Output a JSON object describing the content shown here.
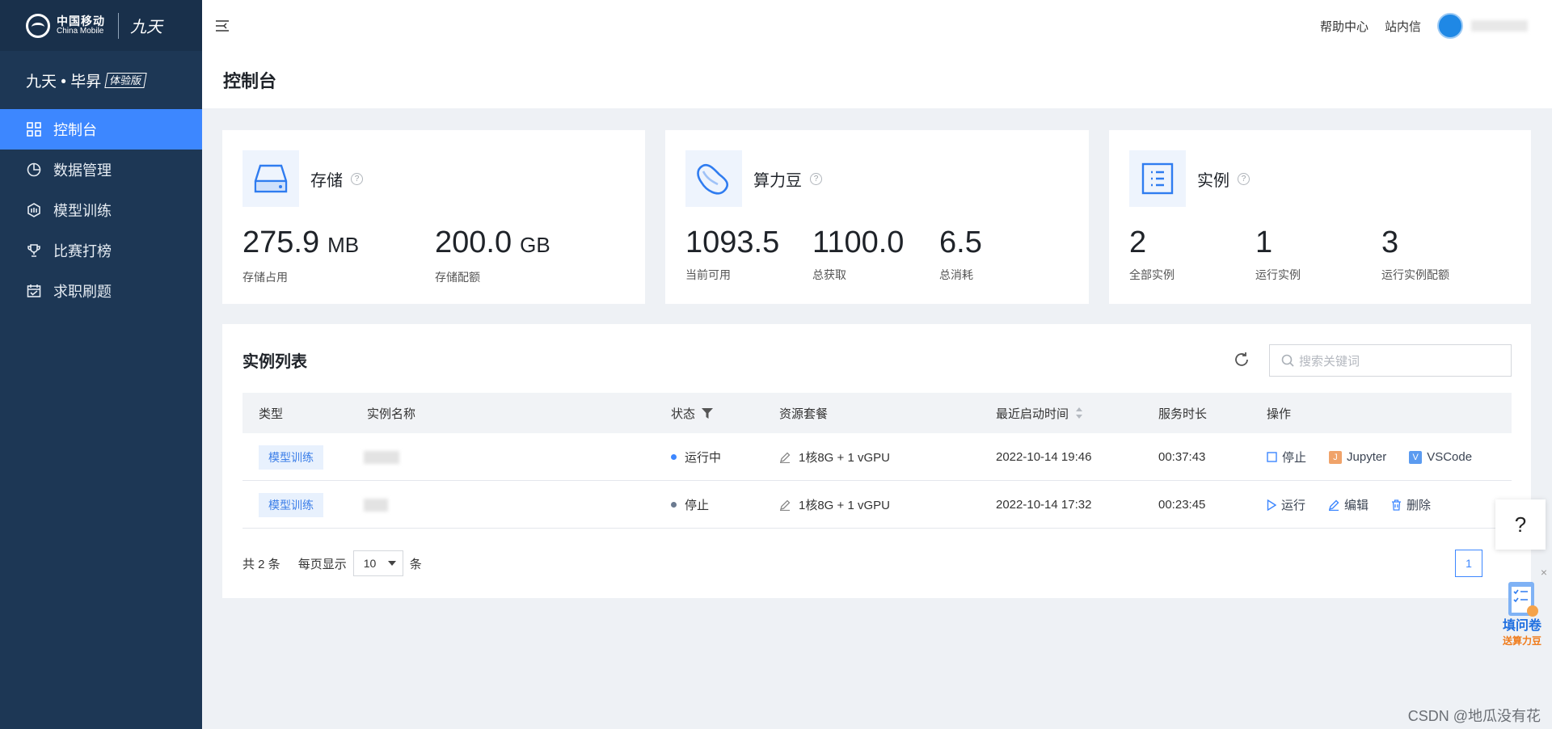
{
  "logo": {
    "cn": "中国移动",
    "en": "China Mobile",
    "script": "九天"
  },
  "brand": {
    "name": "九天 • 毕昇",
    "tag": "体验版"
  },
  "sidebar": {
    "items": [
      {
        "label": "控制台",
        "icon": "grid-icon",
        "active": true
      },
      {
        "label": "数据管理",
        "icon": "pie-chart-icon"
      },
      {
        "label": "模型训练",
        "icon": "hexagon-cube-icon"
      },
      {
        "label": "比赛打榜",
        "icon": "trophy-icon"
      },
      {
        "label": "求职刷题",
        "icon": "calendar-check-icon"
      }
    ]
  },
  "header": {
    "help": "帮助中心",
    "messages": "站内信"
  },
  "page": {
    "title": "控制台"
  },
  "cards": {
    "storage": {
      "title": "存储",
      "used": {
        "value": "275.9",
        "unit": "MB",
        "label": "存储占用"
      },
      "quota": {
        "value": "200.0",
        "unit": "GB",
        "label": "存储配额"
      }
    },
    "beans": {
      "title": "算力豆",
      "available": {
        "value": "1093.5",
        "label": "当前可用"
      },
      "earned": {
        "value": "1100.0",
        "label": "总获取"
      },
      "spent": {
        "value": "6.5",
        "label": "总消耗"
      }
    },
    "instances": {
      "title": "实例",
      "all": {
        "value": "2",
        "label": "全部实例"
      },
      "running": {
        "value": "1",
        "label": "运行实例"
      },
      "quota": {
        "value": "3",
        "label": "运行实例配额"
      }
    }
  },
  "instance_list": {
    "title": "实例列表",
    "search_placeholder": "搜索关键词",
    "columns": [
      "类型",
      "实例名称",
      "状态",
      "资源套餐",
      "最近启动时间",
      "服务时长",
      "操作"
    ],
    "rows": [
      {
        "type": "模型训练",
        "status": "运行中",
        "status_color": "#3d87ff",
        "resource": "1核8G + 1 vGPU",
        "started": "2022-10-14 19:46",
        "duration": "00:37:43",
        "actions": [
          "停止",
          "Jupyter",
          "VSCode"
        ]
      },
      {
        "type": "模型训练",
        "status": "停止",
        "status_color": "#6b7a90",
        "resource": "1核8G + 1 vGPU",
        "started": "2022-10-14 17:32",
        "duration": "00:23:45",
        "actions": [
          "运行",
          "编辑",
          "删除"
        ]
      }
    ],
    "pager": {
      "total": "共 2 条",
      "per_page_label": "每页显示",
      "page_size": "10",
      "unit": "条",
      "current_page": "1"
    }
  },
  "float": {
    "help": "?",
    "survey_title": "填问卷",
    "survey_sub": "送算力豆",
    "close": "×"
  },
  "watermark": "CSDN @地瓜没有花",
  "colors": {
    "sidebar": "#1d3755",
    "accent": "#3d87ff",
    "background": "#eef1f5"
  }
}
